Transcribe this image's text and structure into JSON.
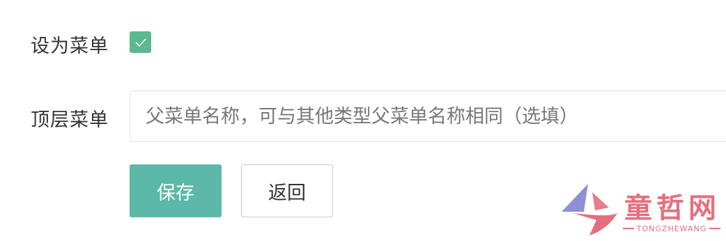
{
  "form": {
    "set_as_menu_label": "设为菜单",
    "set_as_menu_checked": true,
    "top_menu_label": "顶层菜单",
    "top_menu_placeholder": "父菜单名称，可与其他类型父菜单名称相同（选填）",
    "top_menu_value": ""
  },
  "buttons": {
    "save_label": "保存",
    "back_label": "返回"
  },
  "watermark": {
    "text": "童哲网",
    "subtext": "TONGZHEWANG"
  },
  "colors": {
    "checkbox": "#5cb88f",
    "primary": "#5cb8a8",
    "watermark": "#e4707f",
    "watermark_shape": "#8e8fd6"
  }
}
